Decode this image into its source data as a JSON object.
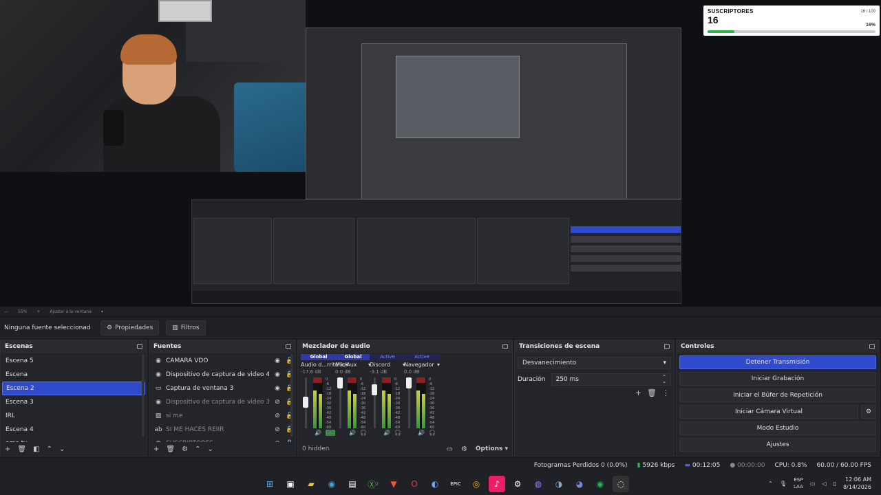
{
  "overlay": {
    "title": "SUSCRIPTORES",
    "count": "16",
    "goal": "16 / 100",
    "percent": "16%",
    "progress": 0.16
  },
  "zoom": {
    "level": "55%",
    "fit_label": "Ajustar a la ventana"
  },
  "source_toolbar": {
    "no_selection": "Ninguna fuente seleccionad",
    "properties": "Propiedades",
    "filters": "Filtros"
  },
  "scenes": {
    "title": "Escenas",
    "items": [
      {
        "label": "Escena 5"
      },
      {
        "label": "Escena"
      },
      {
        "label": "Escena 2",
        "selected": true
      },
      {
        "label": "Escena 3"
      },
      {
        "label": "IRL"
      },
      {
        "label": "Escena 4"
      },
      {
        "label": "ome tv"
      }
    ]
  },
  "sources": {
    "title": "Fuentes",
    "items": [
      {
        "label": "CAMARA VDO",
        "icon": "camera-icon",
        "visible": true
      },
      {
        "label": "Dispositivo de captura de video 4",
        "icon": "camera-icon",
        "visible": true
      },
      {
        "label": "Captura de ventana 3",
        "icon": "window-icon",
        "visible": true
      },
      {
        "label": "Dispositivo de captura de video 3",
        "icon": "camera-icon",
        "visible": false
      },
      {
        "label": "si me",
        "icon": "image-icon",
        "visible": false
      },
      {
        "label": "SI ME HACES REIIR",
        "icon": "text-icon",
        "visible": false
      },
      {
        "label": "SUSCRIPTORES",
        "icon": "globe-icon",
        "visible": false
      }
    ]
  },
  "mixer": {
    "title": "Mezclador de audio",
    "channels": [
      {
        "badge": "Global",
        "name": "Audio d...rritorio",
        "db": "-17.6 dB",
        "active": false
      },
      {
        "badge": "Global",
        "name": "Mic/Aux",
        "db": "0.0 dB",
        "active": false
      },
      {
        "badge": "Active",
        "name": "Discord",
        "db": "-3.1 dB",
        "active": true
      },
      {
        "badge": "Active",
        "name": "Navegador",
        "db": "0.0 dB",
        "active": true
      }
    ],
    "scale": [
      "0",
      "-6",
      "-12",
      "-18",
      "-24",
      "-30",
      "-36",
      "-42",
      "-48",
      "-54",
      "-60"
    ],
    "hidden_label": "0 hidden",
    "options_label": "Options"
  },
  "transitions": {
    "title": "Transiciones de escena",
    "selected": "Desvanecimiento",
    "duration_label": "Duración",
    "duration_value": "250 ms"
  },
  "controls": {
    "title": "Controles",
    "stop_stream": "Detener Transmisión",
    "start_recording": "Iniciar Grabación",
    "start_replay": "Iniciar el Búfer de Repetición",
    "start_vcam": "Iniciar Cámara Virtual",
    "studio_mode": "Modo Estudio",
    "settings": "Ajustes"
  },
  "status": {
    "dropped": "Fotogramas Perdidos 0 (0.0%)",
    "bitrate": "5926 kbps",
    "stream_time": "00:12:05",
    "rec_time": "00:00:00",
    "cpu": "CPU: 0.8%",
    "fps": "60.00 / 60.00 FPS"
  },
  "taskbar": {
    "lang_top": "ESP",
    "lang_bottom": "LAA",
    "time": "12:06 AM",
    "date": "8/14/2026",
    "badge_count": "2"
  },
  "colors": {
    "accent": "#2f4bcc",
    "meter_green": "#2f9a3a",
    "meter_red": "#8a1f24",
    "overlay_bar": "#2fb34a"
  }
}
